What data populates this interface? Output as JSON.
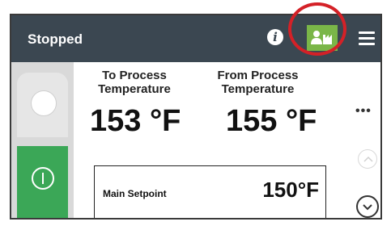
{
  "header": {
    "status": "Stopped",
    "info_icon": "info-icon",
    "plant_icon": "plant-process-icon",
    "menu_icon": "hamburger-menu-icon"
  },
  "columns": {
    "to_process_label": "To Process\nTemperature",
    "from_process_label": "From Process\nTemperature",
    "to_process_value": "153 °F",
    "from_process_value": "155 °F"
  },
  "setpoint": {
    "label": "Main Setpoint",
    "value": "150°F"
  },
  "controls": {
    "off_icon": "circle-off-icon",
    "on_icon": "power-icon",
    "more_icon": "more-dots-icon",
    "more_text": "•••"
  },
  "colors": {
    "header_bg": "#3b4751",
    "plant_button_bg": "#7ab648",
    "on_button_bg": "#3ba757",
    "highlight_ring": "#d42127"
  }
}
